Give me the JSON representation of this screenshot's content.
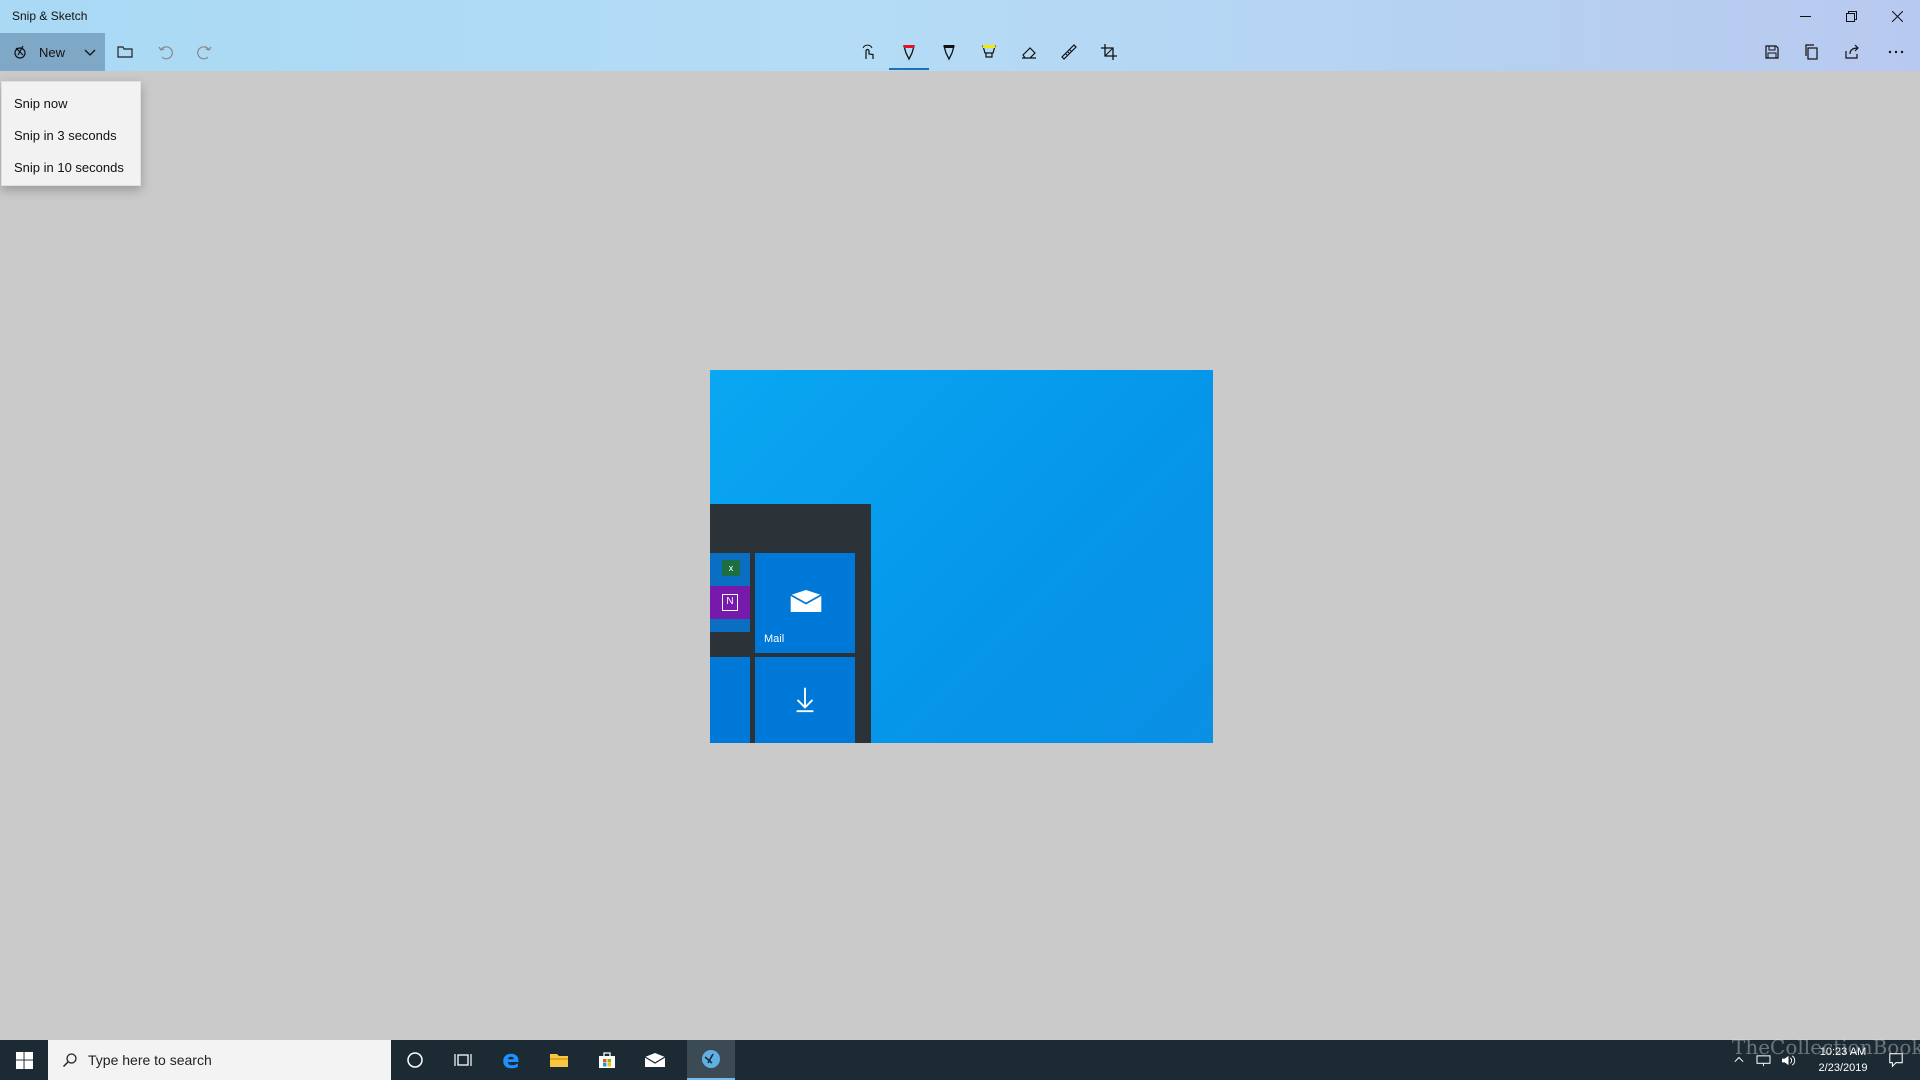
{
  "window": {
    "title": "Snip & Sketch"
  },
  "toolbar": {
    "new_label": "New",
    "tools": [
      "touch-writing-icon",
      "ballpoint-pen-icon",
      "pencil-icon",
      "highlighter-icon",
      "eraser-icon",
      "ruler-icon",
      "crop-icon"
    ],
    "right_tools": [
      "save-icon",
      "copy-icon",
      "share-icon",
      "more-icon"
    ]
  },
  "new_menu": {
    "items": [
      "Snip now",
      "Snip in 3 seconds",
      "Snip in 10 seconds"
    ]
  },
  "snip": {
    "mail_tile_label": "Mail"
  },
  "taskbar": {
    "search_placeholder": "Type here to search",
    "time": "10:23 AM",
    "date": "2/23/2019",
    "watermark": "TheCollectionBook"
  },
  "colors": {
    "accent": "#0078d7",
    "title_gradient_start": "#a9d9f5",
    "canvas_bg": "#cacaca",
    "taskbar_bg": "#1c2a33"
  }
}
